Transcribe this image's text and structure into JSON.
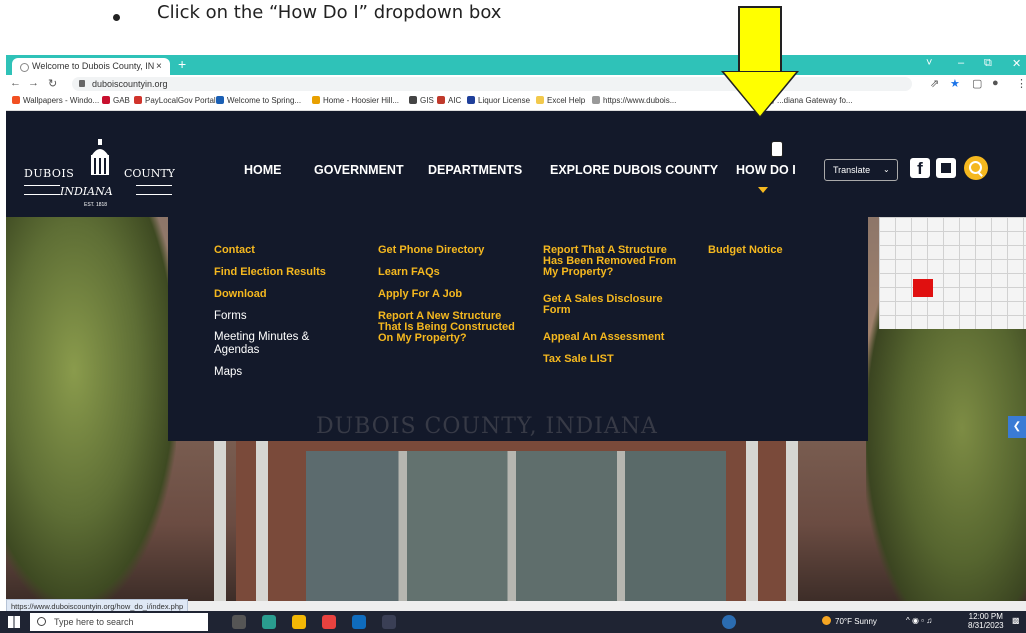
{
  "instruction": {
    "text": "Click on the “How Do I” dropdown box"
  },
  "browser": {
    "tab_title": "Welcome to Dubois County, IN",
    "tab_close": "×",
    "new_tab": "+",
    "url": "duboiscountyin.org",
    "window_controls": {
      "chevron": "˅",
      "minimize": "–",
      "restore": "⧉",
      "close": "✕"
    },
    "bookmarks": [
      {
        "label": "Wallpapers - Windo...",
        "color": "#f25022"
      },
      {
        "label": "GAB",
        "color": "#c8102e"
      },
      {
        "label": "PayLocalGov Portal",
        "color": "#d0342c"
      },
      {
        "label": "Welcome to Spring...",
        "color": "#1a5fb4"
      },
      {
        "label": "Home - Hoosier Hill...",
        "color": "#e8a000"
      },
      {
        "label": "GIS",
        "color": "#444444"
      },
      {
        "label": "AIC",
        "color": "#c0392b"
      },
      {
        "label": "Liquor License",
        "color": "#1f3f9a"
      },
      {
        "label": "Excel Help",
        "color": "#f2c94c"
      },
      {
        "label": "https://www.dubois...",
        "color": "#999999"
      },
      {
        "label": "...diana Gateway fo...",
        "color": "#999999"
      }
    ]
  },
  "site": {
    "logo": {
      "left": "DUBOIS",
      "right": "COUNTY",
      "state": "INDIANA",
      "est": "EST. 1818"
    },
    "nav": [
      "HOME",
      "GOVERNMENT",
      "DEPARTMENTS",
      "EXPLORE DUBOIS COUNTY",
      "HOW DO I"
    ],
    "translate_label": "Translate",
    "facebook_letter": "f",
    "watermark": "DUBOIS COUNTY, INDIANA",
    "status_url": "https://www.duboiscountyin.org/how_do_i/index.php",
    "dropdown": {
      "col1": [
        "Contact",
        "Find Election Results",
        "Download",
        "Forms",
        "Meeting Minutes & Agendas",
        "Maps"
      ],
      "col2": [
        "Get Phone Directory",
        "Learn FAQs",
        "Apply For A Job",
        "Report A New Structure That Is Being Constructed On My Property?"
      ],
      "col3": [
        "Report That A Structure Has Been Removed From My Property?",
        "Get A Sales Disclosure Form",
        "Appeal An Assessment",
        "Tax Sale LIST"
      ],
      "col4": [
        "Budget Notice"
      ]
    }
  },
  "taskbar": {
    "search_placeholder": "Type here to search",
    "weather": "70°F Sunny",
    "time": "12:00 PM",
    "date": "8/31/2023"
  },
  "colors": {
    "header": "#13192a",
    "accent": "#f5b81f",
    "tab_bar": "#2fc2b8",
    "arrow": "#ffff00"
  }
}
